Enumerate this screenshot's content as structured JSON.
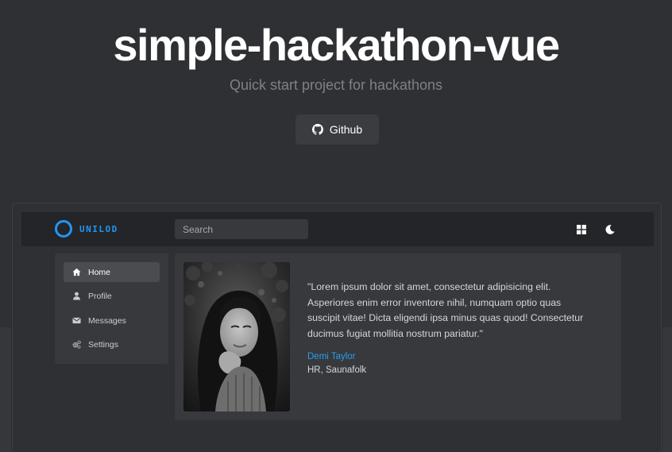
{
  "hero": {
    "title": "simple-hackathon-vue",
    "subtitle": "Quick start project for hackathons",
    "github_label": "Github",
    "github_icon": "github-icon"
  },
  "preview": {
    "navbar": {
      "logo_text": "UNILOD",
      "search_placeholder": "Search",
      "icons": [
        "grid-icon",
        "moon-icon"
      ]
    },
    "sidebar": {
      "items": [
        {
          "label": "Home",
          "icon": "home-icon",
          "active": true
        },
        {
          "label": "Profile",
          "icon": "user-icon",
          "active": false
        },
        {
          "label": "Messages",
          "icon": "envelope-icon",
          "active": false
        },
        {
          "label": "Settings",
          "icon": "cogs-icon",
          "active": false
        }
      ]
    },
    "card": {
      "quote": "\"Lorem ipsum dolor sit amet, consectetur adipisicing elit. Asperiores enim error inventore nihil, numquam optio quas suscipit vitae! Dicta eligendi ipsa minus quas quod! Consectetur ducimus fugiat mollitia nostrum pariatur.\"",
      "author_name": "Demi Taylor",
      "author_role": "HR, Saunafolk"
    }
  },
  "colors": {
    "background": "#2f3034",
    "accent": "#2196f3",
    "panel": "#37393d",
    "navbar": "#242528"
  }
}
